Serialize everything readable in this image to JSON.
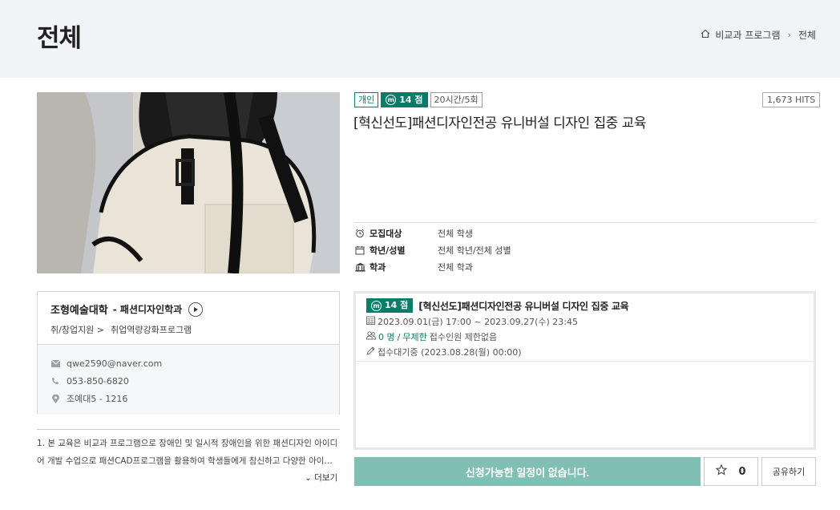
{
  "header": {
    "title": "전체",
    "breadcrumb": {
      "home_icon": "home-icon",
      "item1": "비교과 프로그램",
      "item2": "전체"
    }
  },
  "program": {
    "badge_type": "개인",
    "points": "14 점",
    "duration": "20시간/5회",
    "hits": "1,673 HITS",
    "title": "[혁신선도]패션디자인전공 유니버설 디자인 집중 교육",
    "info": [
      {
        "icon": "alarm-icon",
        "label": "모집대상",
        "value": "전체 학생"
      },
      {
        "icon": "calendar-icon",
        "label": "학년/성별",
        "value": "전체 학년/전체 성별"
      },
      {
        "icon": "bank-icon",
        "label": "학과",
        "value": "전체 학과"
      }
    ]
  },
  "university": {
    "name": "조형예술대학",
    "dept": "- 패션디자인학과",
    "category": "취/창업지원 >",
    "subcategory": "취업역량강화프로그램",
    "email": "qwe2590@naver.com",
    "phone": "053-850-6820",
    "location": "조예대5 - 1216"
  },
  "description": {
    "line1": "1. 본 교육은 비교과 프로그램으로 장애인 및 일시적 장애인을 위한 패션디자인 아이디",
    "line2": "어 개발 수업으로 패션CAD프로그램을 활용하여 학생들에게 참신하고 다양한 아이디…",
    "more": "더보기"
  },
  "schedule": {
    "points": "14 점",
    "title": "[혁신선도]패션디자인전공 유니버설 디자인 집중 교육",
    "period": "2023.09.01(금) 17:00 ~ 2023.09.27(수) 23:45",
    "count": "0 명",
    "slash": "/",
    "limit": "무제한",
    "limit_note": "접수인원 제한없음",
    "apply_basis": "접수대기중 (2023.08.28(월) 00:00)"
  },
  "actions": {
    "apply": "신청가능한 일정이 없습니다.",
    "like_count": "0",
    "share": "공유하기"
  },
  "colors": {
    "accent": "#0a7d6a",
    "apply_disabled": "#7fbfb4",
    "header_bg": "#f2f3f7"
  }
}
